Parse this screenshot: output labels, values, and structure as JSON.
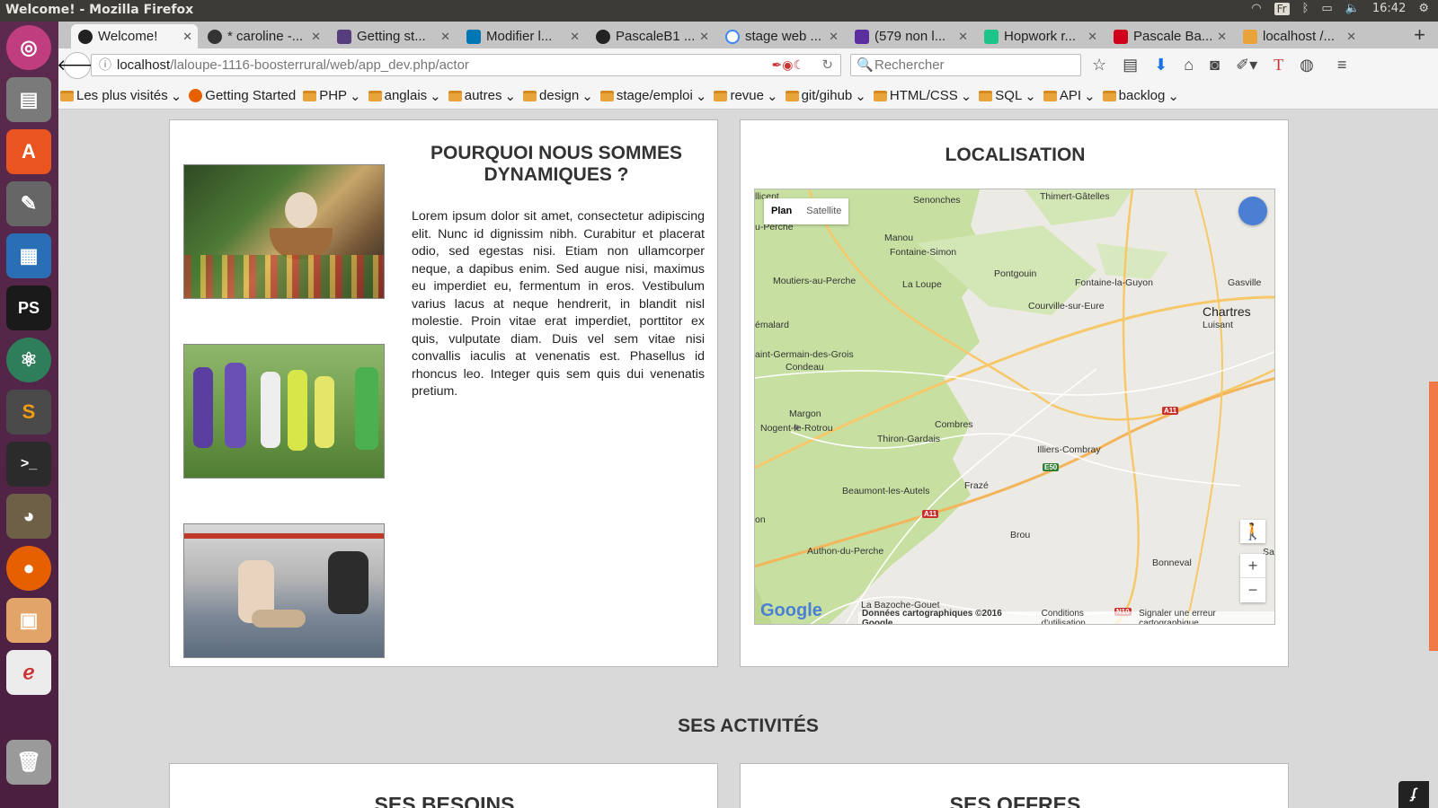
{
  "window": {
    "title": "Welcome! - Mozilla Firefox"
  },
  "tray": {
    "keyboard": "Fr",
    "clock": "16:42"
  },
  "tabs": [
    {
      "label": "Welcome!",
      "active": true,
      "color": "#222222"
    },
    {
      "label": "* caroline -...",
      "color": "#222222"
    },
    {
      "label": "Getting st...",
      "color": "#563d7c"
    },
    {
      "label": "Modifier l...",
      "color": "#0077b5"
    },
    {
      "label": "PascaleB1 ...",
      "color": "#222222"
    },
    {
      "label": "stage web ...",
      "color": "#4285f4"
    },
    {
      "label": "(579 non l...",
      "color": "#5b2fa0"
    },
    {
      "label": "Hopwork r...",
      "color": "#1dc48a"
    },
    {
      "label": "Pascale Ba...",
      "color": "#d0021b"
    },
    {
      "label": "localhost /...",
      "color": "#e8a33a"
    }
  ],
  "url": {
    "host": "localhost",
    "path": "/laloupe-1116-boosterrural/web/app_dev.php/actor"
  },
  "search": {
    "placeholder": "Rechercher"
  },
  "bookmarks": [
    {
      "label": "Les plus visités",
      "dropdown": true
    },
    {
      "label": "Getting Started",
      "dropdown": false
    },
    {
      "label": "PHP",
      "dropdown": true
    },
    {
      "label": "anglais",
      "dropdown": true
    },
    {
      "label": "autres",
      "dropdown": true
    },
    {
      "label": "design",
      "dropdown": true
    },
    {
      "label": "stage/emploi",
      "dropdown": true
    },
    {
      "label": "revue",
      "dropdown": true
    },
    {
      "label": "git/gihub",
      "dropdown": true
    },
    {
      "label": "HTML/CSS",
      "dropdown": true
    },
    {
      "label": "SQL",
      "dropdown": true
    },
    {
      "label": "API",
      "dropdown": true
    },
    {
      "label": "backlog",
      "dropdown": true
    }
  ],
  "page": {
    "dynamic": {
      "title": "POURQUOI NOUS SOMMES DYNAMIQUES ?",
      "body": "Lorem ipsum dolor sit amet, consectetur adipiscing elit. Nunc id dignissim nibh. Curabitur et placerat odio, sed egestas nisi. Etiam non ullamcorper neque, a dapibus enim. Sed augue nisi, maximus eu imperdiet eu, fermentum in eros. Vestibulum varius lacus at neque hendrerit, in blandit nisl molestie. Proin vitae erat imperdiet, porttitor ex quis, vulputate diam. Duis vel sem vitae nisi convallis iaculis at venenatis est. Phasellus id rhoncus leo. Integer quis sem quis dui venenatis pretium."
    },
    "localisation": {
      "title": "LOCALISATION"
    },
    "activities_title": "SES ACTIVITÉS",
    "besoins_title": "SES BESOINS",
    "offres_title": "SES OFFRES"
  },
  "map": {
    "type_plan": "Plan",
    "type_satellite": "Satellite",
    "zoom_in": "+",
    "zoom_out": "−",
    "google": "Google",
    "attribution": "Données cartographiques ©2016 Google",
    "terms": "Conditions d'utilisation",
    "report": "Signaler une erreur cartographique",
    "places": [
      "llicent",
      "Senonches",
      "Thimert-Gâtelles",
      "u-Perche",
      "Manou",
      "Fontaine-Simon",
      "Pontgouin",
      "Moutiers-au-Perche",
      "La Loupe",
      "Fontaine-la-Guyon",
      "Gasville",
      "Courville-sur-Eure",
      "Chartres",
      "Luisant",
      "émalard",
      "aint-Germain-des-Grois",
      "Condeau",
      "Margon",
      "Nogent-le-Rotrou",
      "Combres",
      "Thiron-Gardais",
      "Illiers-Combray",
      "Frazé",
      "Beaumont-les-Autels",
      "on",
      "Brou",
      "Authon-du-Perche",
      "Bonneval",
      "Sar",
      "La Bazoche-Gouet"
    ],
    "roads": [
      "A11",
      "E50",
      "A11",
      "N10"
    ]
  }
}
